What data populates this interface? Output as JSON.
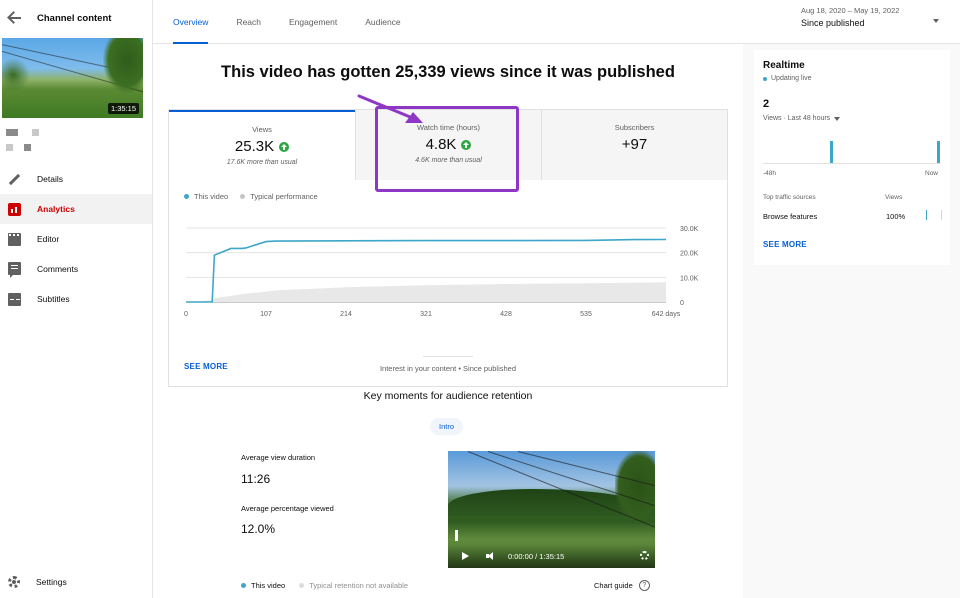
{
  "sidebar": {
    "title": "Channel content",
    "thumbnail_duration": "1:35:15",
    "items": [
      {
        "label": "Details",
        "icon": "pencil-icon"
      },
      {
        "label": "Analytics",
        "icon": "analytics-icon"
      },
      {
        "label": "Editor",
        "icon": "editor-icon"
      },
      {
        "label": "Comments",
        "icon": "comments-icon"
      },
      {
        "label": "Subtitles",
        "icon": "subtitles-icon"
      }
    ],
    "settings_label": "Settings"
  },
  "tabs": [
    {
      "label": "Overview",
      "active": true
    },
    {
      "label": "Reach"
    },
    {
      "label": "Engagement"
    },
    {
      "label": "Audience"
    }
  ],
  "date_range": {
    "range": "Aug 18, 2020 – May 19, 2022",
    "label": "Since published"
  },
  "headline": "This video has gotten 25,339 views since it was published",
  "metrics": [
    {
      "title": "Views",
      "value": "25.3K",
      "trend": "up",
      "sub": "17.6K more than usual"
    },
    {
      "title": "Watch time (hours)",
      "value": "4.8K",
      "trend": "up",
      "sub": "4.6K more than usual"
    },
    {
      "title": "Subscribers",
      "value": "+97",
      "sub": ""
    }
  ],
  "legend": {
    "this_video": "This video",
    "typical": "Typical performance"
  },
  "colors": {
    "this_video": "#3ea6c9",
    "typical": "#c4c4c4",
    "accent": "#065fd4",
    "highlight": "#8e36c6",
    "up": "#2ba640"
  },
  "chart_data": {
    "type": "line",
    "x": [
      0,
      20,
      35,
      38,
      60,
      75,
      80,
      107,
      120,
      214,
      321,
      428,
      535,
      600,
      642
    ],
    "series": [
      {
        "name": "This video",
        "values": [
          0,
          0,
          0,
          19000,
          21700,
          21700,
          21900,
          24500,
          24700,
          24800,
          24900,
          24900,
          24950,
          25300,
          25339
        ]
      },
      {
        "name": "Typical performance",
        "values": [
          0,
          300,
          700,
          1500,
          2500,
          3200,
          3400,
          4200,
          4700,
          6000,
          6800,
          7300,
          7600,
          7800,
          8000
        ]
      }
    ],
    "x_ticks": [
      "0",
      "107",
      "214",
      "321",
      "428",
      "535",
      "642 days"
    ],
    "x_tick_values": [
      0,
      107,
      214,
      321,
      428,
      535,
      642
    ],
    "y_ticks": [
      "0",
      "10.0K",
      "20.0K",
      "30.0K"
    ],
    "y_tick_values": [
      0,
      10000,
      20000,
      30000
    ],
    "xlim": [
      0,
      642
    ],
    "ylim": [
      0,
      30000
    ],
    "grid": true
  },
  "see_more": "SEE MORE",
  "interest": "Interest in your content • Since published",
  "key_moments": {
    "title": "Key moments for audience retention",
    "chip": "Intro",
    "avg_view_duration_label": "Average view duration",
    "avg_view_duration": "11:26",
    "avg_pct_label": "Average percentage viewed",
    "avg_pct": "12.0%",
    "player_time": "0:00:00 / 1:35:15",
    "legend_this": "This video",
    "legend_typical": "Typical retention not available",
    "chart_guide": "Chart guide"
  },
  "realtime": {
    "title": "Realtime",
    "live": "Updating live",
    "count": "2",
    "period": "Views · Last 48 hours",
    "axis_start": "-48h",
    "axis_end": "Now",
    "traffic_header": "Top traffic sources",
    "views_header": "Views",
    "source": "Browse features",
    "source_pct": "100%",
    "see_more": "SEE MORE"
  }
}
